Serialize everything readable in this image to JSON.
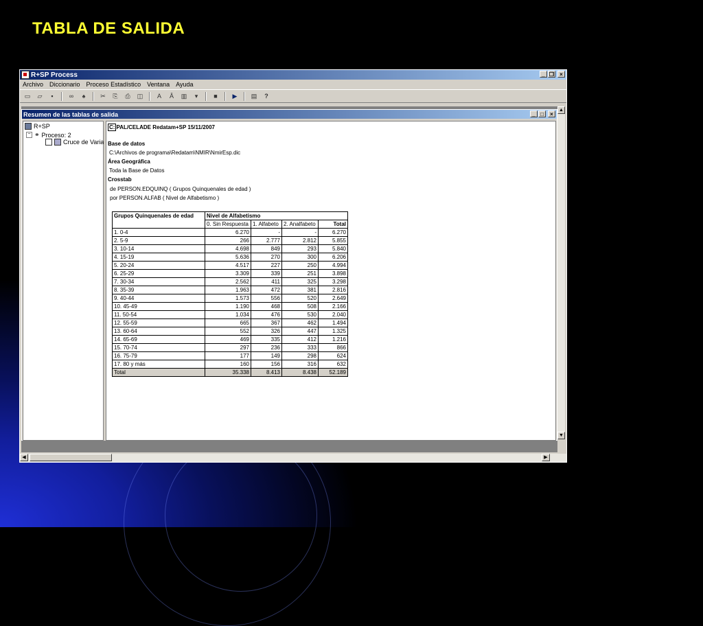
{
  "slide": {
    "title": "TABLA DE SALIDA"
  },
  "window": {
    "title": "R+SP Process",
    "menu": [
      "Archivo",
      "Diccionario",
      "Proceso Estadístico",
      "Ventana",
      "Ayuda"
    ],
    "controls": {
      "min": "_",
      "restore": "❐",
      "close": "×"
    }
  },
  "child_window": {
    "title": "Resumen de las tablas de salida"
  },
  "tree": {
    "root": "R+SP",
    "process": "Proceso: 2",
    "item": "Cruce de Varia"
  },
  "report": {
    "header_prefix": "C:",
    "header": "PAL/CELADE Redatam+SP 15/11/2007",
    "db_label": "Base de datos",
    "db_path": "C:\\Archivos de programa\\Redatam\\NMIR\\NmirEsp.dic",
    "area_label": "Área Geográfica",
    "area_value": "Toda la Base de Datos",
    "crosstab_label": "Crosstab",
    "crosstab_row": "de PERSON.EDQUINQ ( Grupos Quinquenales de edad )",
    "crosstab_col": "por PERSON.ALFAB ( Nivel de Alfabetismo )"
  },
  "table": {
    "row_header": "Grupos Quinquenales de edad",
    "col_group": "Nivel de Alfabetismo",
    "columns": [
      "0. Sin Respuesta",
      "1. Alfabeto",
      "2. Analfabeto",
      "Total"
    ],
    "rows": [
      [
        "1. 0-4",
        "6.270",
        "-",
        "-",
        "6.270"
      ],
      [
        "2. 5-9",
        "266",
        "2.777",
        "2.812",
        "5.855"
      ],
      [
        "3. 10-14",
        "4.698",
        "849",
        "293",
        "5.840"
      ],
      [
        "4. 15-19",
        "5.636",
        "270",
        "300",
        "6.206"
      ],
      [
        "5. 20-24",
        "4.517",
        "227",
        "250",
        "4.994"
      ],
      [
        "6. 25-29",
        "3.309",
        "339",
        "251",
        "3.898"
      ],
      [
        "7. 30-34",
        "2.562",
        "411",
        "325",
        "3.298"
      ],
      [
        "8. 35-39",
        "1.963",
        "472",
        "381",
        "2.816"
      ],
      [
        "9. 40-44",
        "1.573",
        "556",
        "520",
        "2.649"
      ],
      [
        "10. 45-49",
        "1.190",
        "468",
        "508",
        "2.166"
      ],
      [
        "11. 50-54",
        "1.034",
        "476",
        "530",
        "2.040"
      ],
      [
        "12. 55-59",
        "665",
        "367",
        "462",
        "1.494"
      ],
      [
        "13. 60-64",
        "552",
        "326",
        "447",
        "1.325"
      ],
      [
        "14. 65-69",
        "469",
        "335",
        "412",
        "1.216"
      ],
      [
        "15. 70-74",
        "297",
        "236",
        "333",
        "866"
      ],
      [
        "16. 75-79",
        "177",
        "149",
        "298",
        "624"
      ],
      [
        "17. 80 y más",
        "160",
        "156",
        "316",
        "632"
      ]
    ],
    "total": [
      "Total",
      "35.338",
      "8.413",
      "8.438",
      "52.189"
    ]
  }
}
